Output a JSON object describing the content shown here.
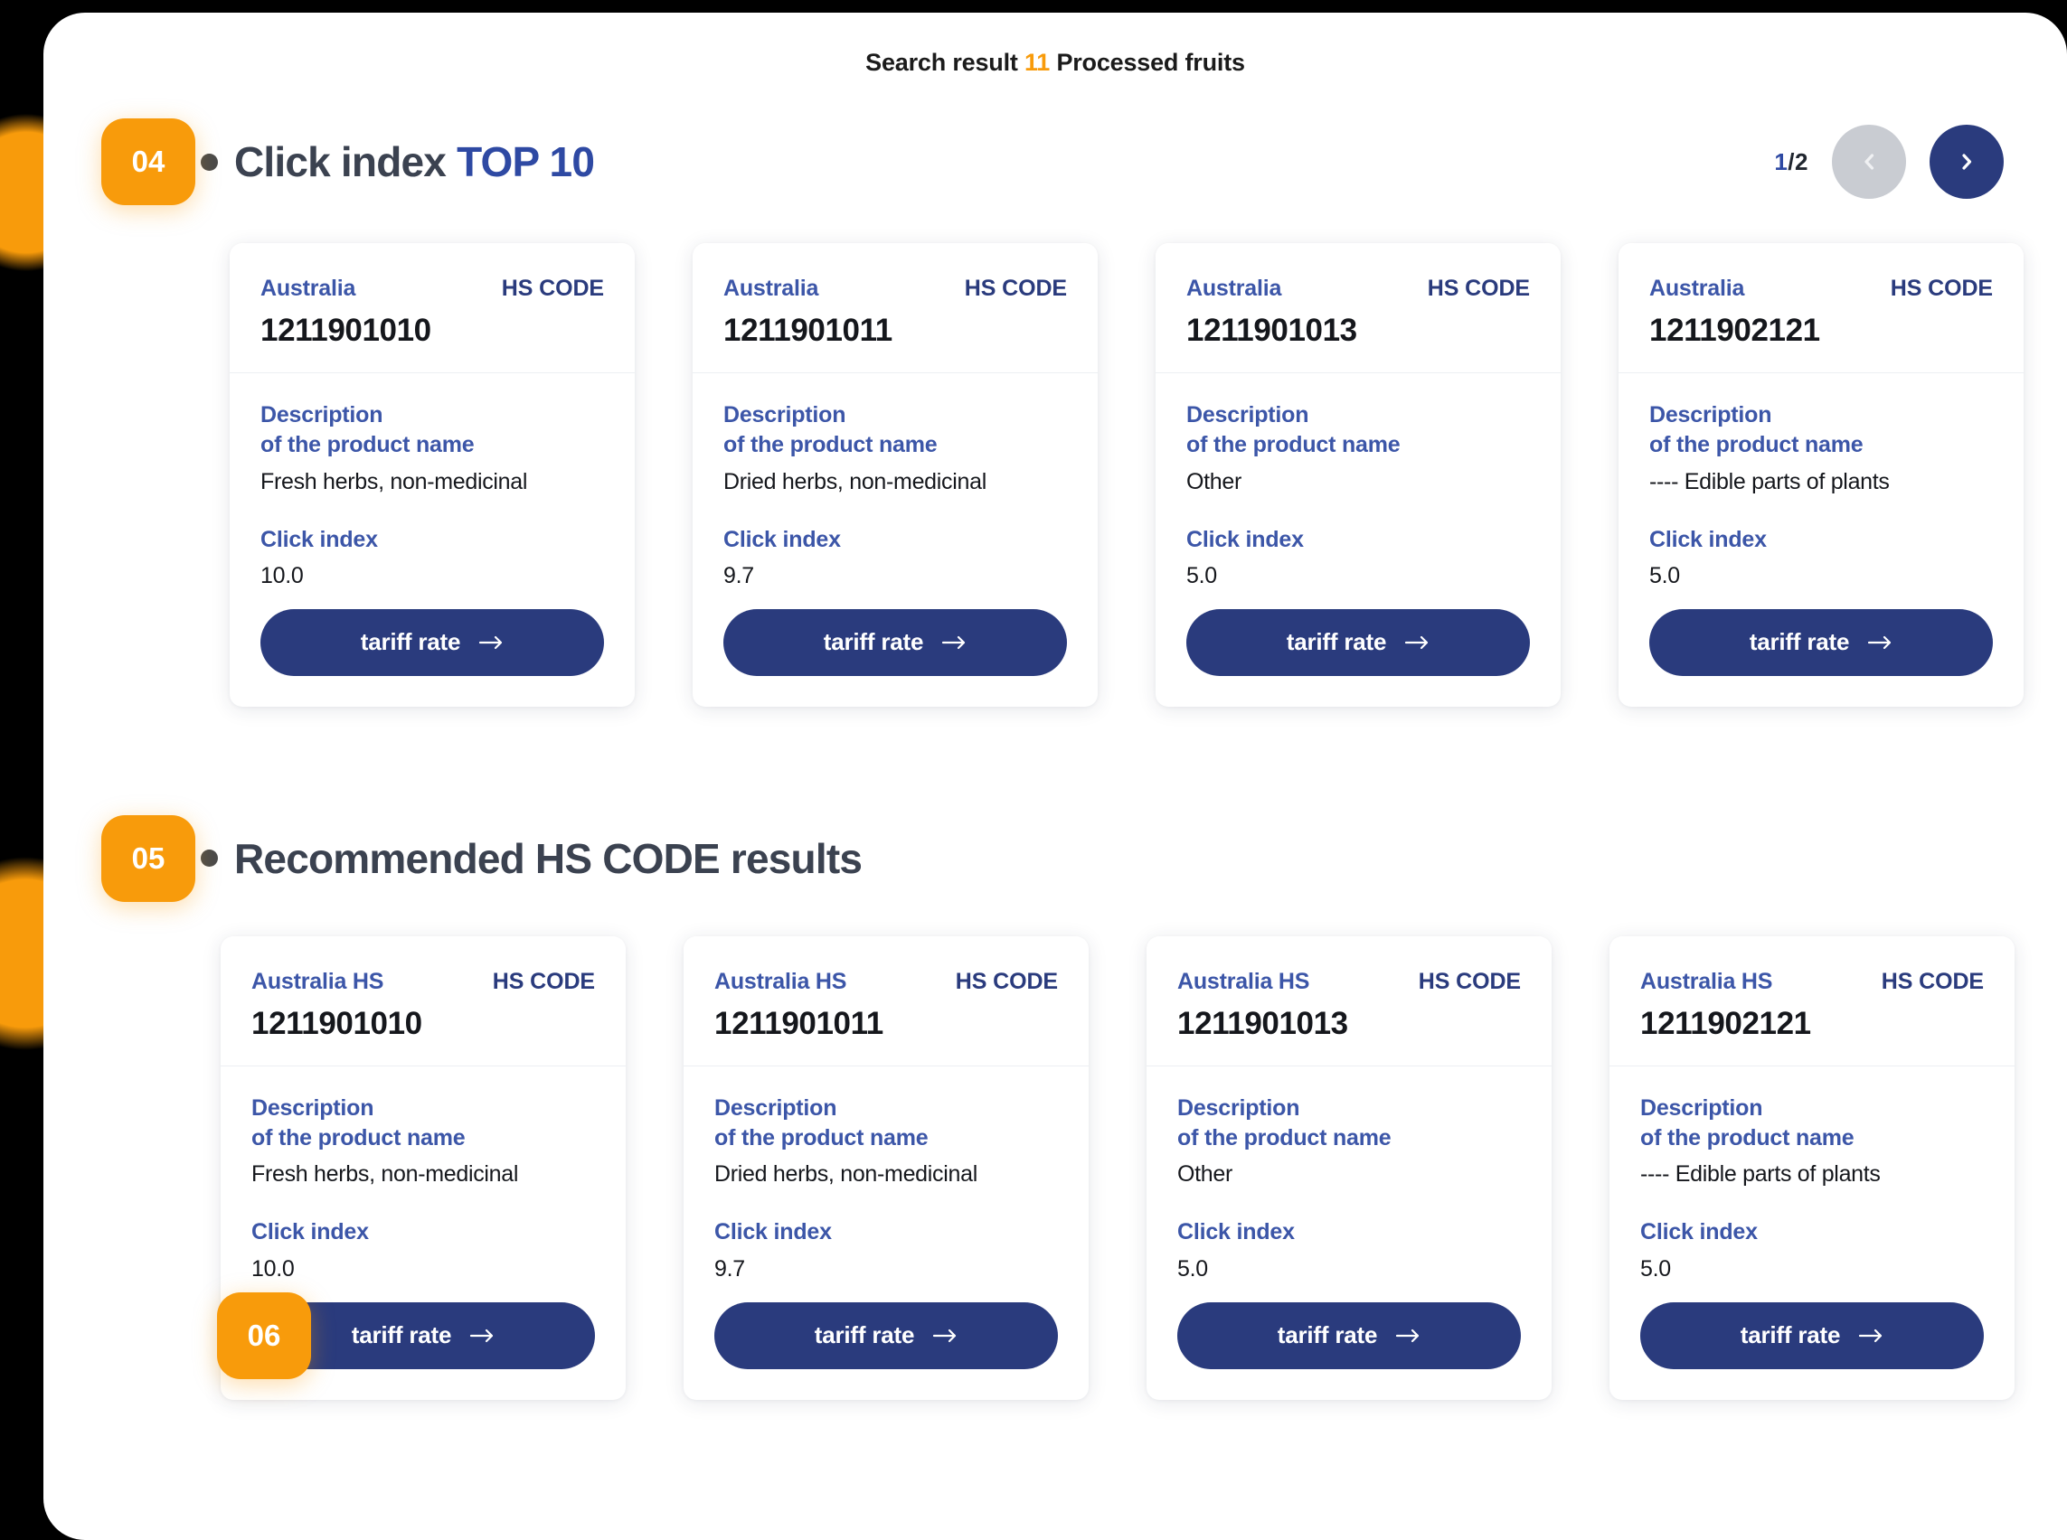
{
  "search_strip": {
    "prefix": "Search result",
    "count": "11",
    "suffix": "Processed fruits"
  },
  "colors": {
    "accent_orange": "#F89B0B",
    "navy": "#2A3B7D",
    "blue_label": "#3C56A8",
    "title_gray": "#3B4250",
    "pager_disabled": "#C9CCD2"
  },
  "sections": [
    {
      "step": "04",
      "title_main": "Click index ",
      "title_accent": "TOP 10",
      "pager": {
        "current": "1",
        "separator": "/",
        "total": "2"
      },
      "cards": [
        {
          "country": "Australia",
          "hs_label": "HS CODE",
          "hs_code": "1211901010",
          "desc_label_line1": "Description",
          "desc_label_line2": "of the product name",
          "desc_value": "Fresh herbs, non-medicinal",
          "click_index_label": "Click index",
          "click_index_value": "10.0",
          "button_label": "tariff rate"
        },
        {
          "country": "Australia",
          "hs_label": "HS CODE",
          "hs_code": "1211901011",
          "desc_label_line1": "Description",
          "desc_label_line2": "of the product name",
          "desc_value": "Dried herbs, non-medicinal",
          "click_index_label": "Click index",
          "click_index_value": "9.7",
          "button_label": "tariff rate"
        },
        {
          "country": "Australia",
          "hs_label": "HS CODE",
          "hs_code": "1211901013",
          "desc_label_line1": "Description",
          "desc_label_line2": "of the product name",
          "desc_value": "Other",
          "click_index_label": "Click index",
          "click_index_value": "5.0",
          "button_label": "tariff rate"
        },
        {
          "country": "Australia",
          "hs_label": "HS CODE",
          "hs_code": "1211902121",
          "desc_label_line1": "Description",
          "desc_label_line2": "of the product name",
          "desc_value": "---- Edible parts of plants",
          "click_index_label": "Click index",
          "click_index_value": "5.0",
          "button_label": "tariff rate"
        }
      ]
    },
    {
      "step": "05",
      "title_main": "Recommended HS CODE results",
      "title_accent": "",
      "button_step": "06",
      "cards": [
        {
          "country": "Australia HS",
          "hs_label": "HS CODE",
          "hs_code": "1211901010",
          "desc_label_line1": "Description",
          "desc_label_line2": "of the product name",
          "desc_value": "Fresh herbs, non-medicinal",
          "click_index_label": "Click index",
          "click_index_value": "10.0",
          "button_label": "tariff rate"
        },
        {
          "country": "Australia HS",
          "hs_label": "HS CODE",
          "hs_code": "1211901011",
          "desc_label_line1": "Description",
          "desc_label_line2": "of the product name",
          "desc_value": "Dried herbs, non-medicinal",
          "click_index_label": "Click index",
          "click_index_value": "9.7",
          "button_label": "tariff rate"
        },
        {
          "country": "Australia HS",
          "hs_label": "HS CODE",
          "hs_code": "1211901013",
          "desc_label_line1": "Description",
          "desc_label_line2": "of the product name",
          "desc_value": "Other",
          "click_index_label": "Click index",
          "click_index_value": "5.0",
          "button_label": "tariff rate"
        },
        {
          "country": "Australia HS",
          "hs_label": "HS CODE",
          "hs_code": "1211902121",
          "desc_label_line1": "Description",
          "desc_label_line2": "of the product name",
          "desc_value": "---- Edible parts of plants",
          "click_index_label": "Click index",
          "click_index_value": "5.0",
          "button_label": "tariff rate"
        }
      ]
    }
  ]
}
